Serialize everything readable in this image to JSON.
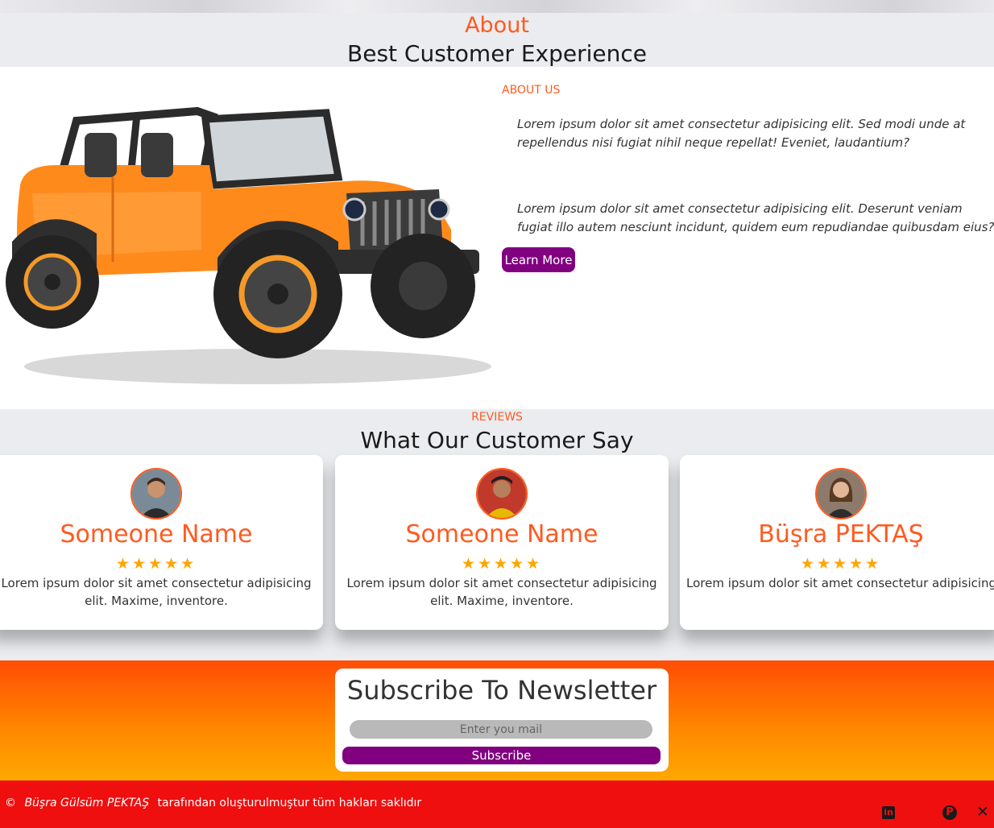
{
  "about": {
    "title": "About",
    "subtitle": "Best Customer Experience",
    "label": "ABOUT US",
    "paragraph1": "Lorem ipsum dolor sit amet consectetur adipisicing elit. Sed modi unde at repellendus nisi fugiat nihil neque repellat! Eveniet, laudantium?",
    "paragraph2": "Lorem ipsum dolor sit amet consectetur adipisicing elit. Deserunt veniam fugiat illo autem nesciunt incidunt, quidem eum repudiandae quibusdam eius?",
    "button": "Learn More",
    "image": "orange-jeep-image"
  },
  "reviews": {
    "label": "REVIEWS",
    "title": "What Our Customer Say",
    "items": [
      {
        "name": "Someone Name",
        "stars": "★★★★★",
        "rating": 5,
        "text": "Lorem ipsum dolor sit amet consectetur adipisicing elit. Maxime, inventore."
      },
      {
        "name": "Someone Name",
        "stars": "★★★★★",
        "rating": 5,
        "text": "Lorem ipsum dolor sit amet consectetur adipisicing elit. Maxime, inventore."
      },
      {
        "name": "Büşra PEKTAŞ",
        "stars": "★★★★★",
        "rating": 5,
        "text": "Lorem ipsum dolor sit amet consectetur adipisicing elit. Maxime, inventore."
      }
    ]
  },
  "newsletter": {
    "title": "Subscribe To Newsletter",
    "placeholder": "Enter you mail",
    "button": "Subscribe"
  },
  "footer": {
    "copyright_symbol": "©",
    "author": "Büşra Gülsüm PEKTAŞ",
    "text": "tarafından oluşturulmuştur tüm hakları saklıdır",
    "social": [
      "linkedin-icon",
      "pinterest-icon",
      "x-icon"
    ]
  },
  "colors": {
    "accent": "#ff5a1f",
    "button": "#80007f",
    "footer": "#ef0f0f",
    "stars": "#ffa500"
  }
}
